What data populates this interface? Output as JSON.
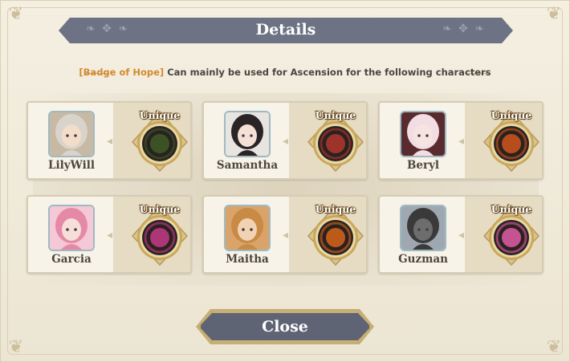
{
  "dialog": {
    "title": "Details",
    "subtitle_item": "[Badge of Hope]",
    "subtitle_rest": " Can mainly be used for Ascension for the following characters",
    "close_label": "Close"
  },
  "unique_label": "Unique",
  "characters": [
    {
      "name": "LilyWill",
      "hair": "#d8d4cc",
      "bg": "#c7b9a4",
      "skin": "#f3dcc9",
      "icon": "bow-icon",
      "icon_color": "#3e5a26"
    },
    {
      "name": "Samantha",
      "hair": "#2b2426",
      "bg": "#e8e4e0",
      "skin": "#f4e0d4",
      "icon": "cloaked-figure-icon",
      "icon_color": "#b3362d"
    },
    {
      "name": "Beryl",
      "hair": "#f1dde3",
      "bg": "#5a2b2e",
      "skin": "#f6e4e0",
      "icon": "fire-burst-icon",
      "icon_color": "#d0541c"
    },
    {
      "name": "Garcia",
      "hair": "#e58aa6",
      "bg": "#f4c8d6",
      "skin": "#f6dfd8",
      "icon": "vortex-icon",
      "icon_color": "#c43a86"
    },
    {
      "name": "Maitha",
      "hair": "#c98a45",
      "bg": "#d9a36a",
      "skin": "#f1d2b2",
      "icon": "flame-warrior-icon",
      "icon_color": "#d6641a"
    },
    {
      "name": "Guzman",
      "hair": "#3a3a3a",
      "bg": "#9fa8b0",
      "skin": "#6d6d6d",
      "icon": "spiral-burst-icon",
      "icon_color": "#e05aa6"
    }
  ],
  "colors": {
    "title_bar": "#6d7384",
    "badge_text": "#d48a2c",
    "close_button": "#5f6475",
    "gold_ring": "#c9a85a"
  }
}
